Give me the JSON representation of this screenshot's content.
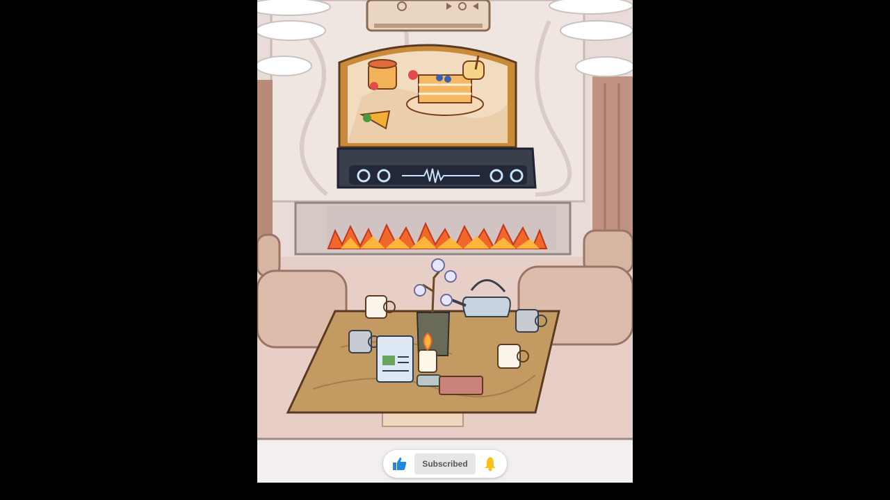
{
  "subscribe_bar": {
    "subscribed_label": "Subscribed",
    "like_icon": "thumbs-up-icon",
    "bell_icon": "bell-icon"
  },
  "colors": {
    "page_background": "#000000",
    "like_blue": "#1e88e5",
    "bell_yellow": "#f9c21a",
    "subscribed_bg": "#e6e6e6"
  }
}
